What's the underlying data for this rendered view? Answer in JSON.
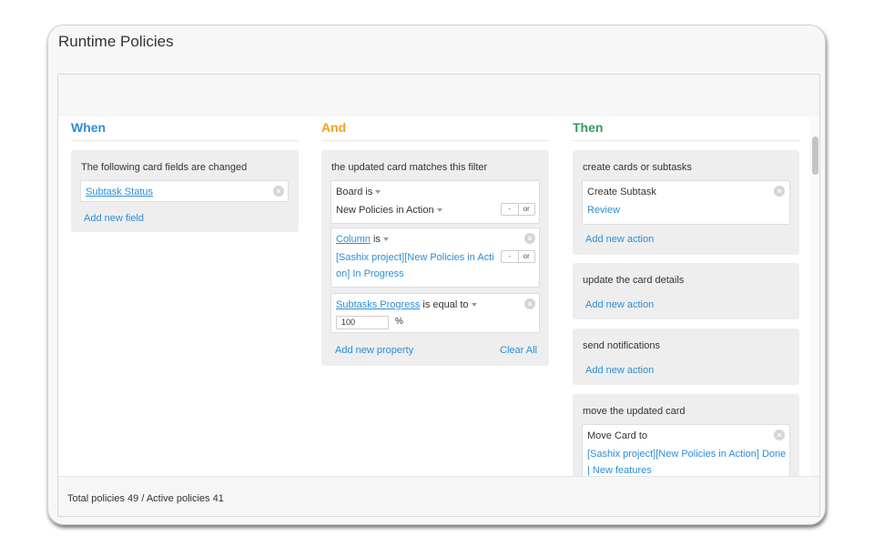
{
  "window": {
    "title": "Runtime Policies"
  },
  "when": {
    "heading": "When",
    "group_title": "The following card fields are changed",
    "field": "Subtask Status",
    "add_label": "Add new field"
  },
  "and": {
    "heading": "And",
    "group_title": "the updated card matches this filter",
    "board": {
      "label": "Board",
      "op": "is",
      "value": "New Policies in Action"
    },
    "column": {
      "label": "Column",
      "op": "is",
      "value_line1": "[Sashix project][New Policies in Acti",
      "value_line2": "on] In Progress"
    },
    "subtasks": {
      "label": "Subtasks Progress",
      "op": "is equal to",
      "value": "100",
      "unit": "%"
    },
    "toggle": {
      "minus": "-",
      "or": "or"
    },
    "add_label": "Add new property",
    "clear_label": "Clear All"
  },
  "then": {
    "heading": "Then",
    "groups": {
      "create": {
        "title": "create cards or subtasks",
        "item_label": "Create Subtask",
        "item_value": "Review",
        "add_label": "Add new action"
      },
      "update": {
        "title": "update the card details",
        "add_label": "Add new action"
      },
      "notify": {
        "title": "send notifications",
        "add_label": "Add new action"
      },
      "move": {
        "title": "move the updated card",
        "item_label": "Move Card to",
        "value_line1": "[Sashix project][New Policies in Action] Done",
        "value_line2": "| New features"
      }
    }
  },
  "footer": {
    "summary": "Total policies 49 / Active policies 41"
  },
  "icons": {
    "remove": "remove-circle-icon",
    "dropdown": "caret-down-icon"
  },
  "colors": {
    "when": "#2b8ed6",
    "and": "#f0a21c",
    "then": "#2e9e5e",
    "link": "#2b8ed6"
  }
}
